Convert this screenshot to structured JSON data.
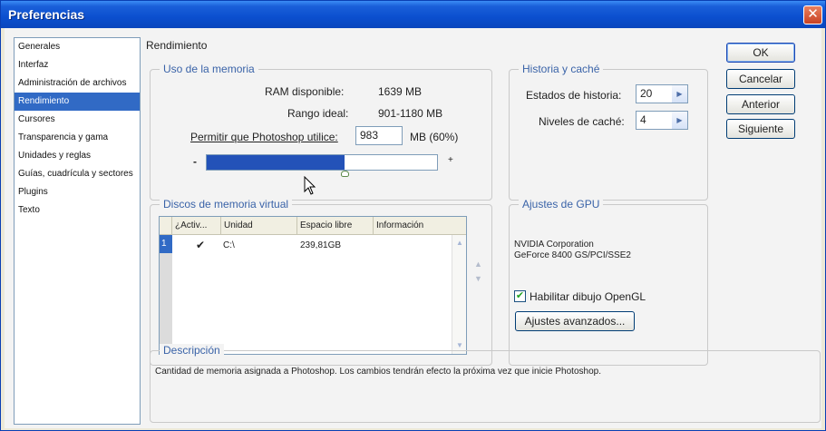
{
  "window": {
    "title": "Preferencias"
  },
  "sidebar": {
    "items": [
      {
        "label": "Generales"
      },
      {
        "label": "Interfaz"
      },
      {
        "label": "Administración de archivos"
      },
      {
        "label": "Rendimiento",
        "selected": true
      },
      {
        "label": "Cursores"
      },
      {
        "label": "Transparencia y gama"
      },
      {
        "label": "Unidades y reglas"
      },
      {
        "label": "Guías, cuadrícula y sectores"
      },
      {
        "label": "Plugins"
      },
      {
        "label": "Texto"
      }
    ]
  },
  "section_title": "Rendimiento",
  "memory": {
    "group_label": "Uso de la memoria",
    "ram_label": "RAM disponible:",
    "ram_value": "1639 MB",
    "ideal_label": "Rango ideal:",
    "ideal_value": "901-1180 MB",
    "allow_label": "Permitir que Photoshop utilice:",
    "allow_value": "983",
    "allow_unit": "MB (60%)",
    "slider_minus": "-",
    "slider_plus": "+",
    "slider_fraction": 0.6
  },
  "history": {
    "group_label": "Historia y caché",
    "states_label": "Estados de historia:",
    "states_value": "20",
    "cache_label": "Niveles de caché:",
    "cache_value": "4"
  },
  "scratch": {
    "group_label": "Discos de memoria virtual",
    "columns": [
      "¿Activ...",
      "Unidad",
      "Espacio libre",
      "Información"
    ],
    "rows": [
      {
        "index": "1",
        "active": "✔",
        "drive": "C:\\",
        "free": "239,81GB",
        "info": ""
      }
    ]
  },
  "gpu": {
    "group_label": "Ajustes de GPU",
    "vendor": "NVIDIA Corporation",
    "model": "GeForce 8400 GS/PCI/SSE2",
    "opengl_label": "Habilitar dibujo OpenGL",
    "opengl_checked": true,
    "advanced_button": "Ajustes avanzados..."
  },
  "description": {
    "group_label": "Descripción",
    "text": "Cantidad de memoria asignada a Photoshop. Los cambios tendrán efecto la próxima vez que inicie Photoshop."
  },
  "buttons": {
    "ok": "OK",
    "cancel": "Cancelar",
    "previous": "Anterior",
    "next": "Siguiente"
  },
  "colors": {
    "title_bar": "#0b4fcf",
    "selection": "#316ac5",
    "slider_fill": "#2352b8",
    "group_label": "#3a63a8"
  }
}
